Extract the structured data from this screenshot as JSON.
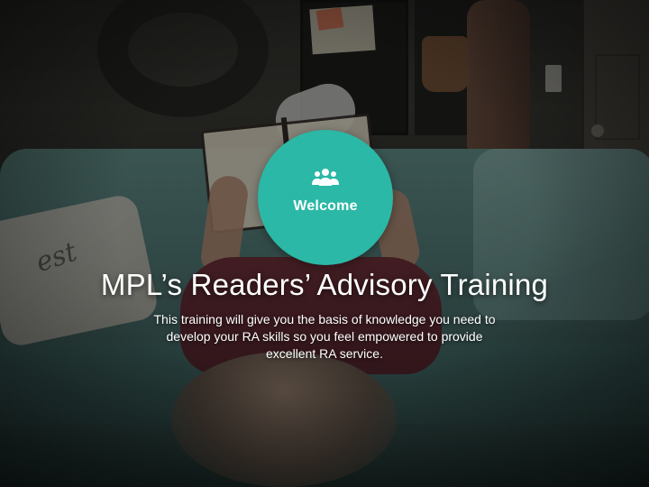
{
  "welcome": {
    "label": "Welcome",
    "icon": "people-group-icon",
    "color": "#2bb8a6"
  },
  "title": "MPL’s Readers’ Advisory Training",
  "description": {
    "line1": "This training will give you the basis of knowledge you need to",
    "line2": "develop your RA skills so you feel empowered to provide",
    "line3": "excellent RA service."
  },
  "background": {
    "pillow_text": "est"
  }
}
